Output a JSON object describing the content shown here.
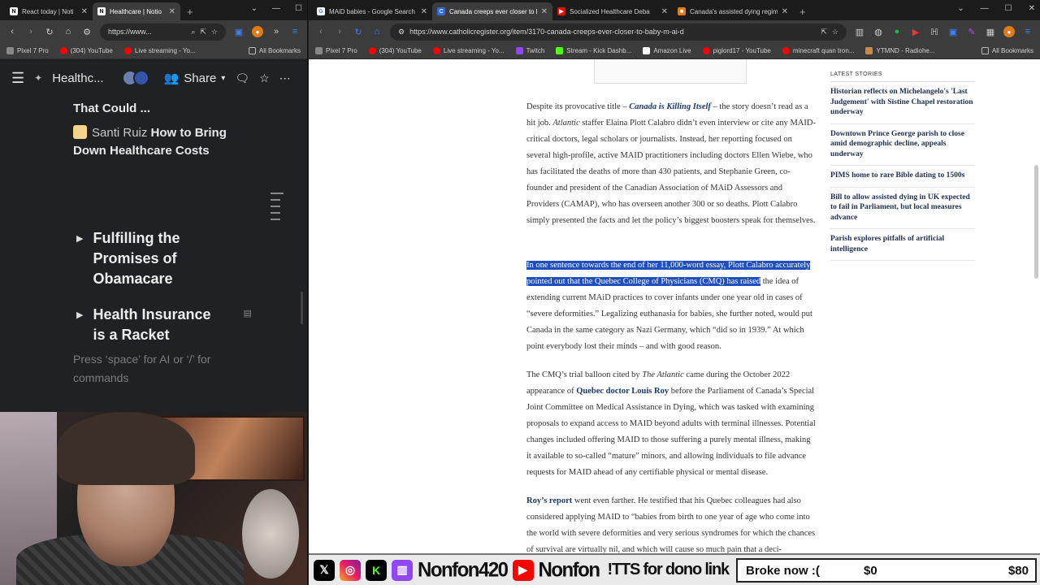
{
  "left_browser": {
    "tabs": [
      {
        "label": "React today | Noti",
        "active": false
      },
      {
        "label": "Healthcare | Notio",
        "active": true
      }
    ],
    "url": "https://www...",
    "bookmarks": [
      "Pixel 7 Pro",
      "(304) YouTube",
      "Live streaming - Yo...",
      "All Bookmarks"
    ]
  },
  "notion": {
    "page_title": "Healthc...",
    "share_label": "Share",
    "partial_line_top": "That Could ...",
    "item_author": "Santi Ruiz",
    "item_title_1": "How to Bring",
    "item_title_2": "Down Healthcare Costs",
    "toggles": [
      {
        "line1": "Fulfilling the",
        "line2": "Promises of",
        "line3": "Obamacare"
      },
      {
        "line1": "Health Insurance",
        "line2": "is a Racket",
        "line3": ""
      }
    ],
    "placeholder": "Press ‘space’ for AI or ‘/’ for commands"
  },
  "right_browser": {
    "tabs": [
      {
        "label": "MAiD babies - Google Search",
        "active": false,
        "color": "#4285f4",
        "glyph": "G"
      },
      {
        "label": "Canada creeps ever closer to ba",
        "active": true,
        "color": "#2d6bd6",
        "glyph": "C"
      },
      {
        "label": "Socialized Healthcare Deba",
        "active": false,
        "color": "#ff0000",
        "glyph": "▶"
      },
      {
        "label": "Canada's assisted dying regime",
        "active": false,
        "color": "#e07b1a",
        "glyph": "■"
      }
    ],
    "url": "https://www.catholicregister.org/item/3170-canada-creeps-ever-closer-to-baby-m-ai-d",
    "bookmarks": [
      "Pixel 7 Pro",
      "(304) YouTube",
      "Live streaming - Yo...",
      "Twitch",
      "Stream - Kick Dashb...",
      "Amazon Live",
      "piglord17 - YouTube",
      "minecraft quan tron...",
      "YTMND - Radiohe...",
      "All Bookmarks"
    ]
  },
  "article": {
    "p1": {
      "t1": "Despite its provocative title – ",
      "link": "Canada is Killing Itself",
      "t2": " – the story doesn’t read as a hit job. ",
      "em": "Atlantic",
      "t3": " staffer Elaina Plott Calabro didn’t even interview or cite any MAID-critical doctors, legal scholars or journalists. Instead, her reporting focused on several high-profile, active MAID practitioners including doctors Ellen Wiebe, who has facilitated the deaths of more than 430 patients, and Stephanie Green, co-founder and president of the Canadian Association of MAiD Assessors and Providers (CAMAP), who has overseen another 300 or so deaths. Plott Calabro simply presented the facts and let the policy’s biggest boosters speak for themselves."
    },
    "p2": {
      "highlight": "In one sentence towards the end of her 11,000-word essay, Plott Calabro accurately pointed out that the Quebec College of Physicians (CMQ) has raised",
      "rest": " the idea of extending current MAiD practices to cover infants under one year old in cases of “severe deformities.” Legalizing euthanasia for babies, she further noted, would put Canada in the same category as Nazi Germany, which “did so in 1939.” At which point everybody lost their minds – and with good reason."
    },
    "p3": {
      "t1": "The CMQ’s trial balloon cited by ",
      "em": "The Atlantic",
      "t2": " came during the October 2022 appearance of ",
      "link": "Quebec doctor Louis Roy",
      "t3": " before the Parliament of Canada’s Special Joint Committee on Medical Assistance in Dying, which was tasked with examining proposals to expand access to MAID beyond adults with terminal illnesses. Potential changes included offering MAID to those suffering a purely mental illness, making it available to so-called “mature” minors, and allowing individuals to file advance requests for MAID ahead of any certifiable physical or mental disease."
    },
    "p4": {
      "link": "Roy’s report",
      "t1": " went even farther. He testified that his Quebec colleagues had also considered applying MAID to “babies from birth to one year of age who come into the world with severe deformities and very serious syndromes for which the chances of survival are virtually nil, and which will cause so much pain that a deci-"
    }
  },
  "sidebar": {
    "heading": "LATEST STORIES",
    "items": [
      "Historian reflects on Michelangelo's 'Last Judgement' with Sistine Chapel restoration underway",
      "Downtown Prince George parish to close amid demographic decline, appeals underway",
      "PIMS home to rare Bible dating to 1500s",
      "Bill to allow assisted dying in UK expected to fail in Parliament, but local measures advance",
      "Parish explores pitfalls of artificial intelligence"
    ]
  },
  "overlay": {
    "handle_1": "Nonfon420",
    "handle_2": "Nonfon",
    "tts": "!TTS for dono link",
    "goal_label": "Broke now :(",
    "goal_current": "$0",
    "goal_target": "$80"
  }
}
